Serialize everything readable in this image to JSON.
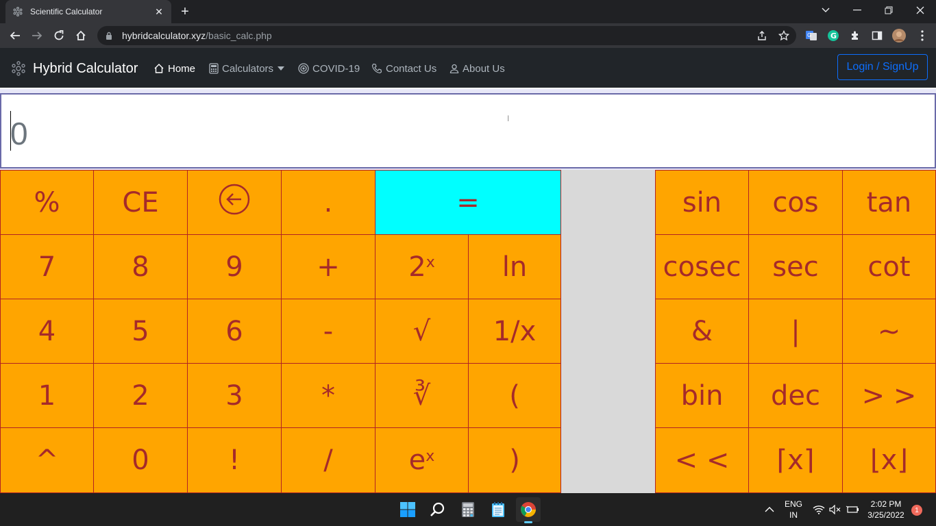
{
  "browser": {
    "tab_title": "Scientific Calculator",
    "url_host": "hybridcalculator.xyz",
    "url_path": "/basic_calc.php"
  },
  "site": {
    "brand": "Hybrid Calculator",
    "nav": {
      "home": "Home",
      "calculators": "Calculators",
      "covid": "COVID-19",
      "contact": "Contact Us",
      "about": "About Us"
    },
    "login": "Login / SignUp"
  },
  "calculator": {
    "display_value": "0",
    "colors": {
      "key_bg": "#ffa500",
      "key_text": "#a52a2a",
      "equals_bg": "#00ffff"
    },
    "keys": {
      "percent": "%",
      "ce": "CE",
      "dot": ".",
      "equals": "=",
      "sin": "sin",
      "cos": "cos",
      "tan": "tan",
      "seven": "7",
      "eight": "8",
      "nine": "9",
      "plus": "+",
      "pow2_base": "2",
      "pow2_sup": "x",
      "ln": "ln",
      "cosec": "cosec",
      "sec": "sec",
      "cot": "cot",
      "four": "4",
      "five": "5",
      "six": "6",
      "minus": "-",
      "sqrt": "√",
      "reciprocal": "1/x",
      "and": "&",
      "or": "|",
      "not": "~",
      "one": "1",
      "two": "2",
      "three": "3",
      "multiply": "*",
      "cbrt": "∛",
      "lparen": "(",
      "bin": "bin",
      "dec": "dec",
      "rshift": "> >",
      "caret": "^",
      "zero": "0",
      "factorial": "!",
      "divide": "/",
      "exp_base": "e",
      "exp_sup": "x",
      "rparen": ")",
      "lshift": "< <",
      "ceil": "⌈x⌉",
      "floor": "⌊x⌋"
    }
  },
  "taskbar": {
    "lang_line1": "ENG",
    "lang_line2": "IN",
    "time": "2:02 PM",
    "date": "3/25/2022",
    "notifications": "1"
  }
}
